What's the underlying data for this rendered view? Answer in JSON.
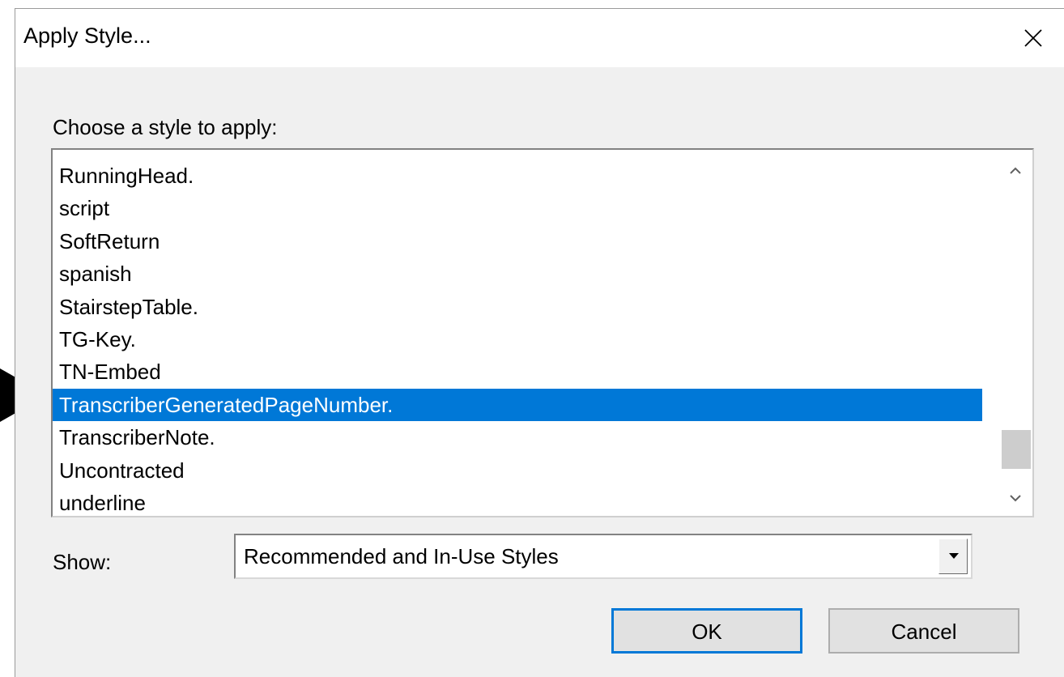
{
  "dialog": {
    "title": "Apply Style...",
    "close_icon": "close-icon",
    "prompt": "Choose a style to apply:",
    "styles": [
      "RunningHead.",
      "script",
      "SoftReturn",
      "spanish",
      "StairstepTable.",
      "TG-Key.",
      "TN-Embed",
      "TranscriberGeneratedPageNumber.",
      "TranscriberNote.",
      "Uncontracted",
      "underline"
    ],
    "selected_style": "TranscriberGeneratedPageNumber.",
    "show_label": "Show:",
    "show_value": "Recommended and In-Use Styles",
    "ok_label": "OK",
    "cancel_label": "Cancel"
  },
  "colors": {
    "selection": "#0078d7",
    "dialog_bg": "#f0f0f0",
    "default_button_border": "#0078d7"
  },
  "icons": {
    "pointer": "arrow-right-icon",
    "scroll_up": "chevron-up-icon",
    "scroll_down": "chevron-down-icon",
    "combo_dropdown": "triangle-down-icon"
  }
}
